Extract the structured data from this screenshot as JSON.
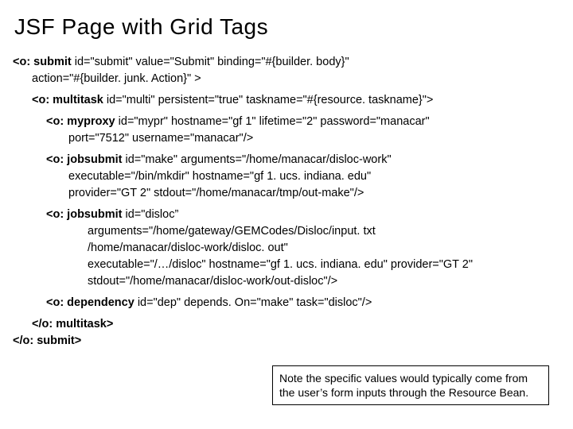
{
  "title": "JSF Page with Grid Tags",
  "lines": {
    "l1a": "<o: submit",
    "l1b": " id=\"submit\" value=\"Submit\" binding=\"#{builder. body}\"",
    "l2": "action=\"#{builder. junk. Action}\" >",
    "l3a": "<o: multitask",
    "l3b": " id=\"multi\" persistent=\"true\" taskname=\"#{resource. taskname}\">",
    "l4a": "<o: myproxy",
    "l4b": " id=\"mypr\" hostname=\"gf 1\" lifetime=\"2\" password=\"manacar\"",
    "l5": "port=\"7512\" username=\"manacar\"/>",
    "l6a": "<o: jobsubmit",
    "l6b": " id=\"make\" arguments=\"/home/manacar/disloc-work\"",
    "l7": "executable=\"/bin/mkdir\" hostname=\"gf 1. ucs. indiana. edu\"",
    "l8": "provider=\"GT 2\" stdout=\"/home/manacar/tmp/out-make\"/>",
    "l9a": "<o: jobsubmit",
    "l9b": " id=\"disloc”",
    "l10": "arguments=\"/home/gateway/GEMCodes/Disloc/input. txt",
    "l11": "/home/manacar/disloc-work/disloc. out\"",
    "l12": "executable=\"/…/disloc\" hostname=\"gf 1. ucs. indiana. edu\" provider=\"GT 2\" stdout=\"/home/manacar/disloc-work/out-disloc\"/>",
    "l13a": "<o: dependency",
    "l13b": " id=\"dep\" depends. On=\"make\" task=\"disloc\"/>",
    "l14": "</o: multitask>",
    "l15": "</o: submit>"
  },
  "note": "Note the specific values would typically come from the user’s form inputs through the Resource Bean."
}
